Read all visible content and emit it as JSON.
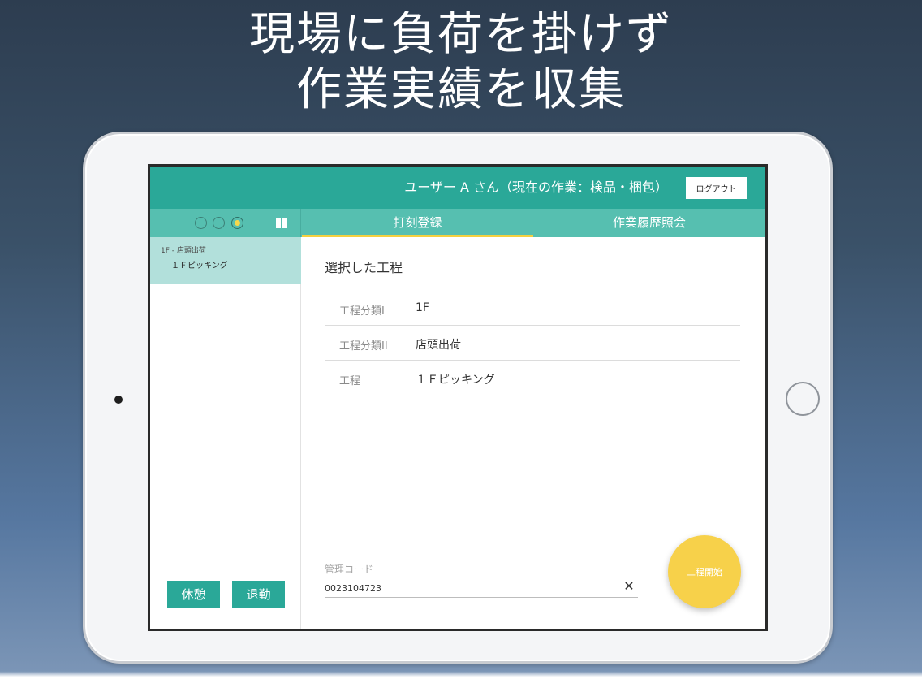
{
  "headline": {
    "line1": "現場に負荷を掛けず",
    "line2": "作業実績を収集"
  },
  "header": {
    "user_status": "ユーザー A さん（現在の作業：検品・梱包）",
    "logout_label": "ログアウト"
  },
  "tabs": [
    {
      "label": "打刻登録",
      "active": true
    },
    {
      "label": "作業履歴照会",
      "active": false
    }
  ],
  "sidebar": {
    "indicator_active_index": 2,
    "items": [
      {
        "category": "1F - 店頭出荷",
        "name": "１Ｆピッキング",
        "selected": true
      }
    ],
    "break_label": "休憩",
    "leave_label": "退勤"
  },
  "main": {
    "section_title": "選択した工程",
    "fields": [
      {
        "label": "工程分類I",
        "value": "1F"
      },
      {
        "label": "工程分類II",
        "value": "店頭出荷"
      },
      {
        "label": "工程",
        "value": "１Ｆピッキング"
      }
    ],
    "code_label": "管理コード",
    "code_value": "0023104723",
    "clear_icon": "close-icon",
    "start_label": "工程開始"
  },
  "colors": {
    "primary": "#2aa898",
    "tab_bar": "#56bfb0",
    "selected_item": "#b2e0db",
    "accent": "#f7d14a"
  }
}
